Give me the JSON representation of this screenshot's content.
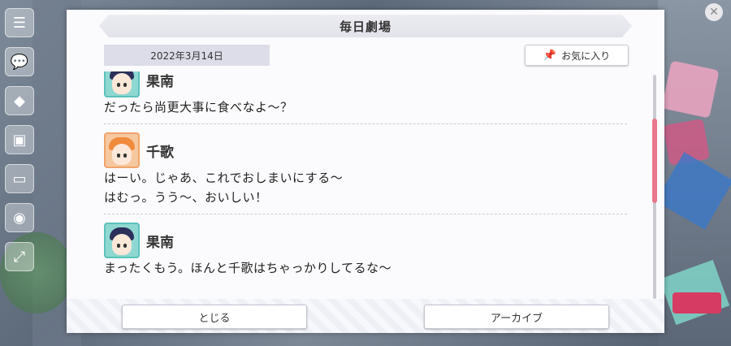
{
  "dialog": {
    "title": "毎日劇場",
    "date": "2022年3月14日",
    "favorite_label": "お気に入り",
    "close_label": "とじる",
    "archive_label": "アーカイブ"
  },
  "entries": [
    {
      "speaker": "果南",
      "lines": [
        "だったら尚更大事に食べなよ～？"
      ]
    },
    {
      "speaker": "千歌",
      "lines": [
        "はーい。じゃあ、これでおしまいにする～",
        "はむっ。うう～、おいしい！"
      ]
    },
    {
      "speaker": "果南",
      "lines": [
        "まったくもう。ほんと千歌はちゃっかりしてるな～"
      ]
    }
  ],
  "colors": {
    "accent_scroll": "#e8788a",
    "kanan_frame": "#5cc2bb",
    "chika_frame": "#f0a46a"
  },
  "icons": [
    "menu-icon",
    "speech-icon",
    "gift-bag-icon",
    "present-icon",
    "screen-icon",
    "watering-can-icon",
    "expand-icon",
    "pin-icon"
  ]
}
